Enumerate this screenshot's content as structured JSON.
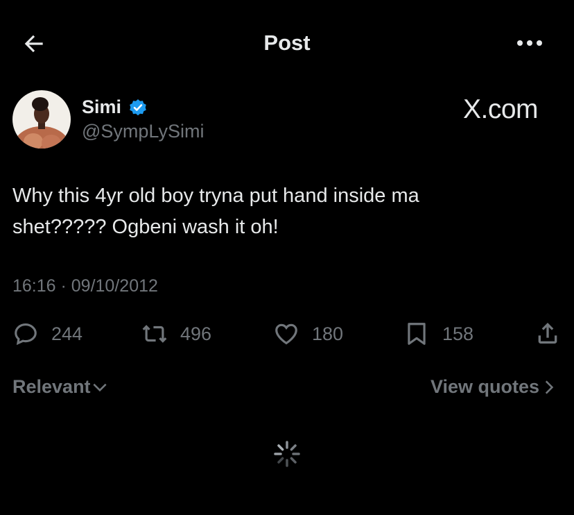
{
  "header": {
    "title": "Post",
    "back_icon": "arrow-left-icon",
    "more_icon": "more-dots-icon"
  },
  "author": {
    "display_name": "Simi",
    "handle": "@SympLySimi",
    "verified_icon": "verified-badge-icon",
    "verified_color": "#1d9bf0"
  },
  "watermark": "X.com",
  "tweet": {
    "text_line1": "Why this 4yr old boy tryna put hand inside ma",
    "text_line2": "shet????? Ogbeni wash it oh!",
    "timestamp": "16:16 · 09/10/2012"
  },
  "actions": {
    "replies": "244",
    "reposts": "496",
    "likes": "180",
    "bookmarks": "158"
  },
  "footer": {
    "sort_label": "Relevant",
    "quotes_label": "View quotes"
  },
  "colors": {
    "background": "#000000",
    "text": "#e7e9ea",
    "muted": "#71767b",
    "accent": "#1d9bf0"
  }
}
